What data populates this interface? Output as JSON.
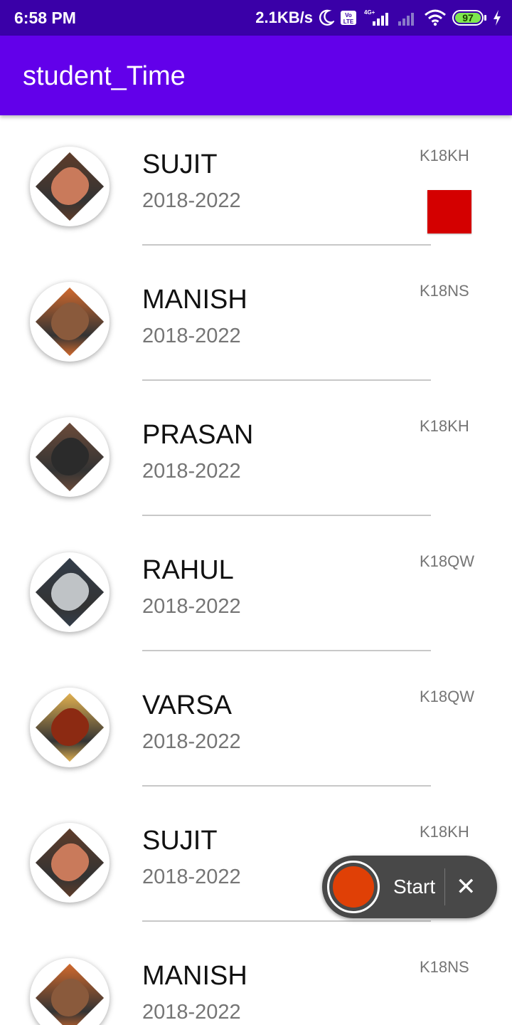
{
  "status_bar": {
    "time": "6:58 PM",
    "net_speed": "2.1KB/s",
    "battery": "97",
    "icons": [
      "moon-icon",
      "volte-icon",
      "signal-4g-icon",
      "signal-icon",
      "wifi-icon",
      "battery-icon",
      "charging-icon"
    ]
  },
  "app_bar": {
    "title": "student_Time"
  },
  "students": [
    {
      "name": "SUJIT",
      "years": "2018-2022",
      "code": "K18KH",
      "avatar": [
        "#c97a5b",
        "#5e3c2a"
      ]
    },
    {
      "name": "MANISH",
      "years": "2018-2022",
      "code": "K18NS",
      "avatar": [
        "#8a5a3c",
        "#d0692d"
      ]
    },
    {
      "name": "PRASAN",
      "years": "2018-2022",
      "code": "K18KH",
      "avatar": [
        "#2b2b2b",
        "#6b4b3a"
      ]
    },
    {
      "name": "RAHUL",
      "years": "2018-2022",
      "code": "K18QW",
      "avatar": [
        "#bfc3c6",
        "#333d4a"
      ]
    },
    {
      "name": "VARSA",
      "years": "2018-2022",
      "code": "K18QW",
      "avatar": [
        "#8c2a12",
        "#e0b050"
      ]
    },
    {
      "name": "SUJIT",
      "years": "2018-2022",
      "code": "K18KH",
      "avatar": [
        "#c97a5b",
        "#5e3c2a"
      ]
    },
    {
      "name": "MANISH",
      "years": "2018-2022",
      "code": "K18NS",
      "avatar": [
        "#8a5a3c",
        "#d0692d"
      ]
    }
  ],
  "marker_color": "#d40000",
  "recorder": {
    "start_label": "Start",
    "close_label": "✕",
    "dot_color": "#e04006"
  }
}
